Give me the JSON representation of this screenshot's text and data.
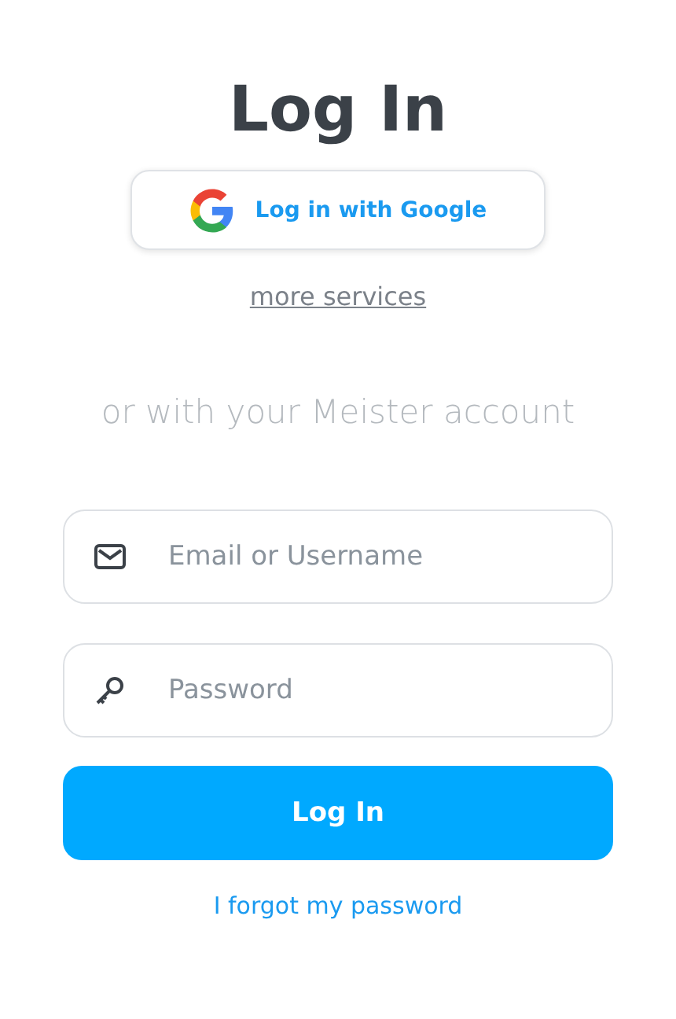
{
  "title": "Log In",
  "google_button": {
    "label": "Log in with Google"
  },
  "more_services": "more services",
  "divider_text": "or with your Meister account",
  "fields": [
    {
      "kind": "email",
      "placeholder": "Email or Username"
    },
    {
      "kind": "password",
      "placeholder": "Password"
    }
  ],
  "submit_button": {
    "label": "Log In"
  },
  "forgot_link": "I forgot my password"
}
